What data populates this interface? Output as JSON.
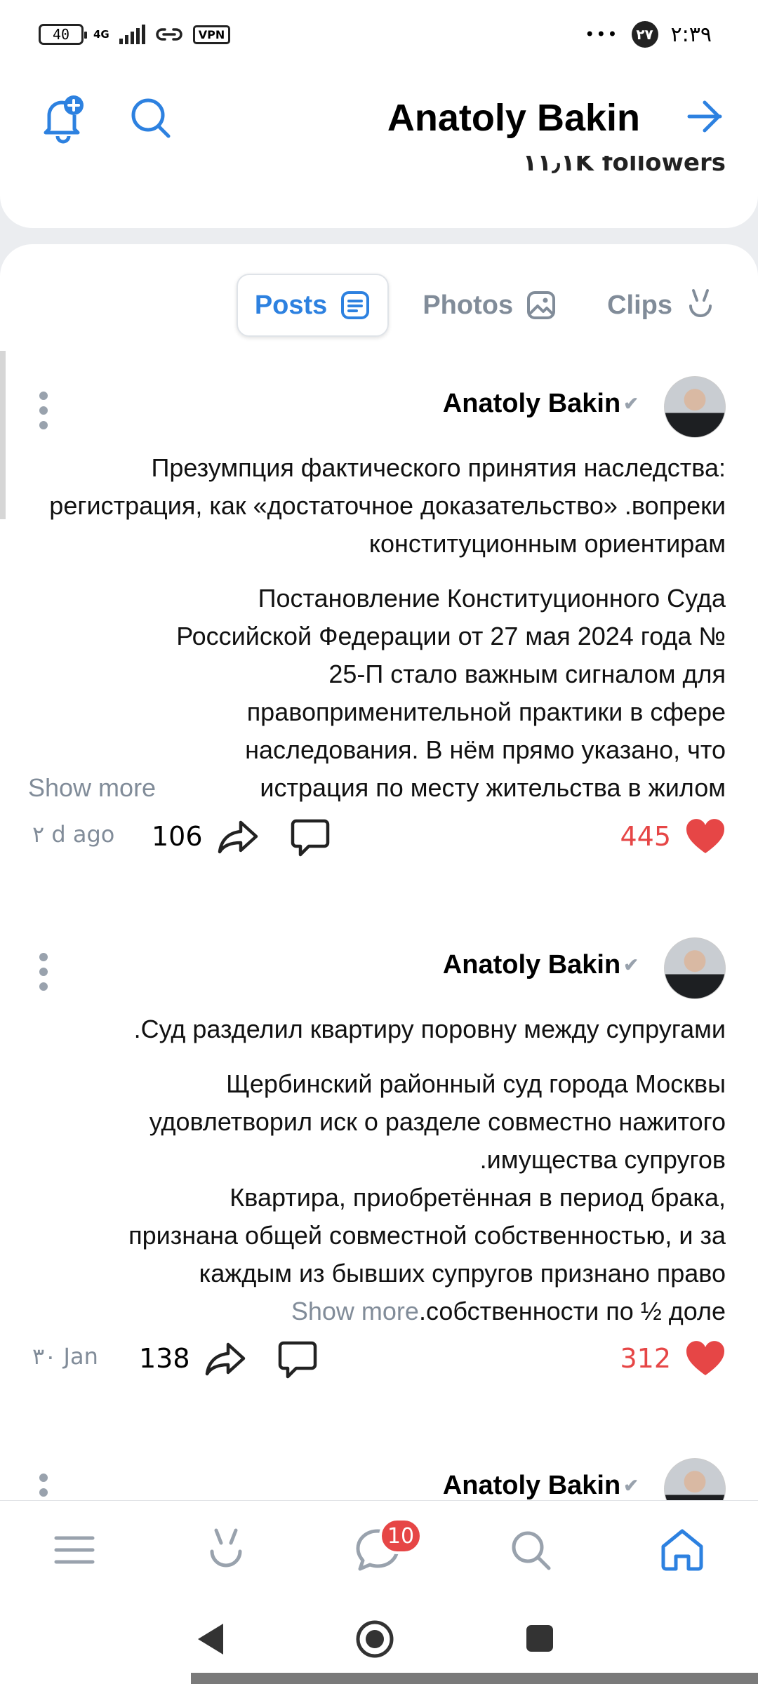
{
  "status_bar": {
    "battery": "40",
    "network": "4G",
    "vpn": "VPN",
    "time": "۲:۳۹",
    "notification_count": "۲۷",
    "more": "•••"
  },
  "header": {
    "title": "Anatoly Bakin",
    "followers": "۱۱٫۱K followers"
  },
  "tabs": [
    {
      "label": "Posts",
      "active": true
    },
    {
      "label": "Photos",
      "active": false
    },
    {
      "label": "Clips",
      "active": false
    }
  ],
  "posts": [
    {
      "author": "Anatoly Bakin",
      "title": "Презумпция фактического принятия наследства: регистрация, как «достаточное доказательство» .вопреки конституционным ориентирам",
      "body_lines": [
        "Постановление Конституционного Суда",
        "Российской Федерации от 27 мая 2024 года №",
        "25-П стало важным сигналом для",
        "правоприменительной практики в сфере",
        "наследования. В нём прямо указано, что"
      ],
      "last_line": "истрация по месту жительства в жилом",
      "show_more": "Show more",
      "date": "۲ d ago",
      "shares": "106",
      "likes": "445"
    },
    {
      "author": "Anatoly Bakin",
      "title": ".Суд разделил квартиру поровну между супругами",
      "body_lines": [
        "Щербинский районный суд города Москвы",
        "удовлетворил иск о разделе совместно нажитого",
        ".имущества супругов",
        "Квартира, приобретённая в период брака,",
        "признана общей совместной собственностью, и за",
        "каждым из бывших супругов признано право"
      ],
      "last_line": ".собственности по ½ доле",
      "show_more": "Show more",
      "date": "۳۰ Jan",
      "shares": "138",
      "likes": "312"
    },
    {
      "author": "Anatoly Bakin"
    }
  ],
  "bottom_nav": {
    "messages_badge": "10"
  },
  "colors": {
    "accent": "#2d81e0",
    "like": "#e64646",
    "muted": "#818c99"
  }
}
